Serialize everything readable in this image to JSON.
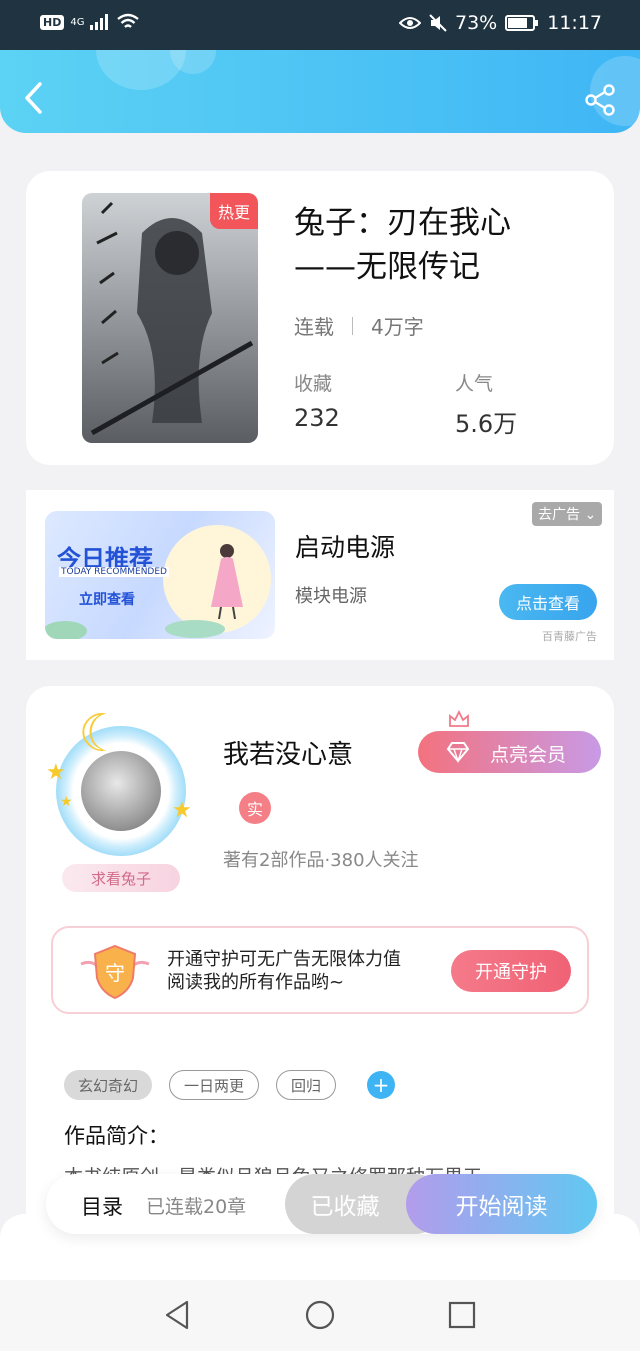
{
  "status_bar": {
    "hd": "HD",
    "network": "4G",
    "battery": "73%",
    "time": "11:17"
  },
  "header": {
    "back_icon": "chevron-left-icon",
    "share_icon": "share-icon"
  },
  "book": {
    "badge": "热更",
    "title_line1": "兔子：刃在我心",
    "title_line2": "——无限传记",
    "status": "连载",
    "word_count": "4万字",
    "collect_label": "收藏",
    "collect_value": "232",
    "popularity_label": "人气",
    "popularity_value": "5.6万"
  },
  "ad": {
    "image_title": "今日推荐",
    "image_subtitle": "TODAY RECOMMENDED",
    "image_button": "立即查看",
    "title": "启动电源",
    "subtitle": "模块电源",
    "close_label": "去广告",
    "button_label": "点击查看",
    "source": "百青藤广告"
  },
  "author": {
    "name": "我若没心意",
    "real_badge": "实",
    "stats": "著有2部作品·380人关注",
    "fan_tag": "求看兔子",
    "vip_button": "点亮会员",
    "guard_text": "开通守护可无广告无限体力值阅读我的所有作品哟~",
    "guard_shield_char": "守",
    "guard_button": "开通守护",
    "tags": [
      "玄幻奇幻",
      "一日两更",
      "回归"
    ],
    "add_tag": "+",
    "intro_title": "作品简介：",
    "intro_text": "本书纯原创，是类似且狼且兔又之修罗那种万界天"
  },
  "bottom_bar": {
    "toc_label": "目录",
    "toc_status": "已连载20章",
    "collected_label": "已收藏",
    "read_label": "开始阅读"
  },
  "colors": {
    "header_gradient_start": "#5cd2f4",
    "header_gradient_end": "#3fb6f5",
    "hot_badge": "#f2555a",
    "vip_gradient_start": "#f3727e",
    "vip_gradient_end": "#c89ae6",
    "read_gradient_start": "#b39cec",
    "read_gradient_end": "#60c8f1"
  }
}
